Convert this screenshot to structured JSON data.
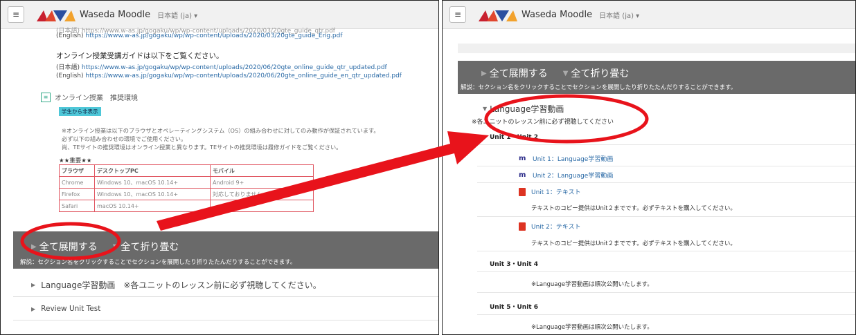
{
  "header": {
    "menu_glyph": "≡",
    "site_name": "Waseda Moodle",
    "lang": "日本語 (ja) ▾"
  },
  "left": {
    "top_cut": "(日本語) https://www.w-as.jp/gogaku/wp/wp-content/uploads/2020/03/20gte_guide_qtr.pdf",
    "top_en_label": "(English)",
    "top_en_url": "https://www.w-as.jp/gogaku/wp/wp-content/uploads/2020/03/20gte_guide_Eng.pdf",
    "online_heading": "オンライン授業受講ガイドは以下をご覧ください。",
    "online_ja_label": "(日本語)",
    "online_ja_url": "https://www.w-as.jp/gogaku/wp/wp-content/uploads/2020/06/20gte_online_guide_qtr_updated.pdf",
    "online_en_label": "(English)",
    "online_en_url": "https://www.w-as.jp/gogaku/wp/wp-content/uploads/2020/06/20gte_online_guide_en_qtr_updated.pdf",
    "env_title": "オンライン授業　推奨環境",
    "hidden_badge": "学生から非表示",
    "notes": [
      "※オンライン授業は以下のブラウザとオペレーティングシステム（OS）の組み合わせに対してのみ動作が保証されています。",
      "必ず以下の組み合わせの環境でご使用ください。",
      "尚、TEサイトの推奨環境はオンライン授業と異なります。TEサイトの推奨環境は履修ガイドをご覧ください。"
    ],
    "important": "★★重要★★",
    "table": {
      "headers": [
        "ブラウザ",
        "デスクトップPC",
        "モバイル"
      ],
      "rows": [
        [
          "Chrome",
          "Windows 10、macOS 10.14+",
          "Android 9+"
        ],
        [
          "Firefox",
          "Windows 10、macOS 10.14+",
          "対応しておりません"
        ],
        [
          "Safari",
          "macOS 10.14+",
          ""
        ]
      ]
    },
    "expand_all": "全て展開する",
    "collapse_all": "全て折り畳む",
    "desc": "解説：セクション名をクリックすることでセクションを展開したり折りたたんだりすることができます。",
    "sections": [
      "Language学習動画　※各ユニットのレッスン前に必ず視聴してください。",
      "Review Unit Test"
    ]
  },
  "right": {
    "expand_all": "全て展開する",
    "collapse_all": "全て折り畳む",
    "desc": "解説：セクション名をクリックすることでセクションを展開したり折りたたんだりすることができます。",
    "section_title": "Language学習動画",
    "section_sub": "※各ユニットのレッスン前に必ず視聴してください",
    "unit12": "Unit 1・Unit 2",
    "activities": [
      "Unit 1：Language学習動画",
      "Unit 2：Language学習動画",
      "Unit 1：テキスト",
      "Unit 2：テキスト"
    ],
    "text_note": "テキストのコピー提供はUnit２までです。必ずテキストを購入してください。",
    "unit34": "Unit 3・Unit 4",
    "unit56": "Unit 5・Unit 6",
    "release_note": "※Language学習動画は順次公開いたします。"
  },
  "colors": {
    "annotation": "#e8131b",
    "gray_bar": "#6a6a6a",
    "link": "#2a6aa6"
  }
}
